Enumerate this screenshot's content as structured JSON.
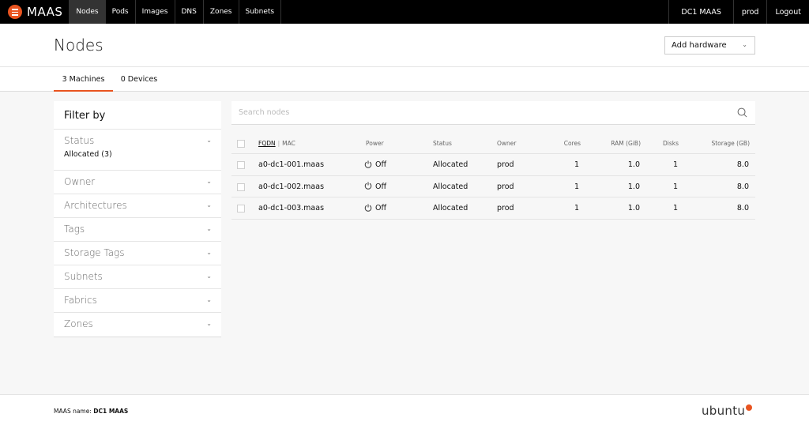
{
  "nav": {
    "brand": "MAAS",
    "items": [
      {
        "label": "Nodes",
        "active": true
      },
      {
        "label": "Pods",
        "active": false
      },
      {
        "label": "Images",
        "active": false
      },
      {
        "label": "DNS",
        "active": false
      },
      {
        "label": "Zones",
        "active": false
      },
      {
        "label": "Subnets",
        "active": false
      }
    ],
    "region": "DC1 MAAS",
    "user": "prod",
    "logout": "Logout"
  },
  "header": {
    "title": "Nodes",
    "add_hardware": "Add hardware"
  },
  "tabs": [
    {
      "label": "3 Machines",
      "active": true
    },
    {
      "label": "0 Devices",
      "active": false
    }
  ],
  "filter": {
    "title": "Filter by",
    "status": {
      "label": "Status",
      "selected": "Allocated (3)"
    },
    "sections": [
      "Owner",
      "Architectures",
      "Tags",
      "Storage Tags",
      "Subnets",
      "Fabrics",
      "Zones"
    ]
  },
  "search": {
    "placeholder": "Search nodes",
    "value": ""
  },
  "table": {
    "headers": {
      "fqdn": "FQDN",
      "separator": "|",
      "mac": "MAC",
      "power": "Power",
      "status": "Status",
      "owner": "Owner",
      "cores": "Cores",
      "ram": "RAM (GiB)",
      "disks": "Disks",
      "storage": "Storage (GB)"
    },
    "rows": [
      {
        "fqdn": "a0-dc1-001.maas",
        "power": "Off",
        "status": "Allocated",
        "owner": "prod",
        "cores": "1",
        "ram": "1.0",
        "disks": "1",
        "storage": "8.0"
      },
      {
        "fqdn": "a0-dc1-002.maas",
        "power": "Off",
        "status": "Allocated",
        "owner": "prod",
        "cores": "1",
        "ram": "1.0",
        "disks": "1",
        "storage": "8.0"
      },
      {
        "fqdn": "a0-dc1-003.maas",
        "power": "Off",
        "status": "Allocated",
        "owner": "prod",
        "cores": "1",
        "ram": "1.0",
        "disks": "1",
        "storage": "8.0"
      }
    ]
  },
  "footer": {
    "name_label": "MAAS name:",
    "name_value": "DC1 MAAS",
    "logo": "ubuntu"
  },
  "colors": {
    "accent": "#e95420",
    "nav_bg": "#000000"
  },
  "icons": [
    "maas-logo-icon",
    "chevron-down-icon",
    "search-icon",
    "power-icon",
    "ubuntu-logo-icon"
  ]
}
